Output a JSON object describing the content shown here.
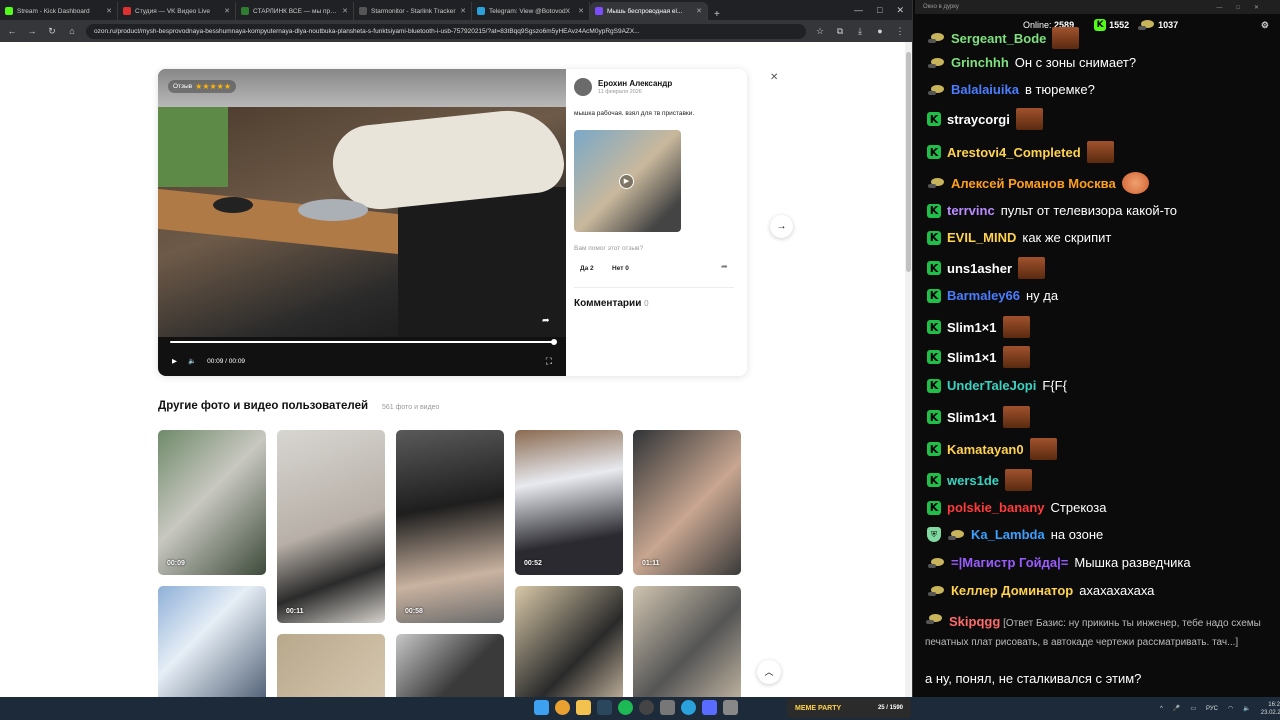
{
  "browser": {
    "tabs": [
      {
        "title": "Stream - Kick Dashboard",
        "color": "#53fc18"
      },
      {
        "title": "Студия — VK Видео Live",
        "color": "#e03131"
      },
      {
        "title": "СТАРЛИНК ВСЁ — мы прогир...",
        "color": "#2e7d32"
      },
      {
        "title": "Starmonitor - Starlink Tracker",
        "color": "#555555"
      },
      {
        "title": "Telegram: View @BotovodX",
        "color": "#2aa1da"
      },
      {
        "title": "Мышь беспроводная el...",
        "color": "#7c4dff"
      }
    ],
    "new_tab": "+",
    "url": "ozon.ru/product/mysh-besprovodnaya-besshumnaya-kompyuternaya-dlya-noutbuka-plansheta-s-funktsiyami-bluetooth-i-usb-757920215/?at=83tBqq9Sgszo6m5yHEAvz4AcM0ypRgS9AZX..."
  },
  "review": {
    "badge": "Отзыв",
    "stars": "★★★★★",
    "author": "Ерохин Александр",
    "date": "11 февраля 2026",
    "text": "мышка рабочая. взял для тв приставки.",
    "helpful_question": "Вам помог этот отзыв?",
    "yes_label": "Да 2",
    "no_label": "Нет 0",
    "comments_label": "Комментарии",
    "comments_count": "0",
    "video_time": "00:09 / 00:09"
  },
  "gallery": {
    "title": "Другие фото и видео пользователей",
    "count": "561 фото и видео",
    "items": [
      {
        "duration": "00:09"
      },
      {
        "duration": "00:11"
      },
      {
        "duration": "00:58"
      },
      {
        "duration": "00:52"
      },
      {
        "duration": "01:11"
      }
    ]
  },
  "chat": {
    "window_title": "Окно в дурку",
    "online_label": "Online:",
    "online_count": "2589",
    "stat1": "1552",
    "stat2": "1037",
    "messages": [
      {
        "user": "Sergeant_Bode",
        "color": "#7ee07e",
        "badge": "g",
        "text": "",
        "emote": true
      },
      {
        "user": "Grinchhh",
        "color": "#7ee07e",
        "badge": "g",
        "text": "Он с зоны снимает?"
      },
      {
        "user": "Balalaiuika",
        "color": "#4a7dff",
        "badge": "g",
        "text": "в тюремке?"
      },
      {
        "user": "straycorgi",
        "color": "#ffffff",
        "badge": "k",
        "text": "",
        "emote": true
      },
      {
        "user": "Arestovi4_Completed",
        "color": "#ffd34d",
        "badge": "k",
        "text": "",
        "emote": true
      },
      {
        "user": "Алексей Романов Москва",
        "color": "#ff9f1a",
        "badge": "g",
        "text": "",
        "emote": true,
        "round": true
      },
      {
        "user": "terrvinc",
        "color": "#b98cff",
        "badge": "k",
        "text": "пульт от телевизора какой-то"
      },
      {
        "user": "EVIL_MIND",
        "color": "#ffd34d",
        "badge": "k",
        "text": "как же скрипит"
      },
      {
        "user": "uns1asher",
        "color": "#ffffff",
        "badge": "k",
        "text": "",
        "emote": true
      },
      {
        "user": "Barmaley66",
        "color": "#4a7dff",
        "badge": "k",
        "text": "ну да"
      },
      {
        "user": "Slim1×1",
        "color": "#ffffff",
        "badge": "k",
        "text": "",
        "emote": true
      },
      {
        "user": "Slim1×1",
        "color": "#ffffff",
        "badge": "k",
        "text": "",
        "emote": true
      },
      {
        "user": "UnderTaleJopi",
        "color": "#3ad3c1",
        "badge": "k",
        "text": "F{F{"
      },
      {
        "user": "Slim1×1",
        "color": "#ffffff",
        "badge": "k",
        "text": "",
        "emote": true
      },
      {
        "user": "Kamatayan0",
        "color": "#ffd34d",
        "badge": "k",
        "text": "",
        "emote": true
      },
      {
        "user": "wers1de",
        "color": "#3ad3c1",
        "badge": "k",
        "text": "",
        "emote": true
      },
      {
        "user": "polskie_banany",
        "color": "#ff3b3b",
        "badge": "k",
        "text": "Стрекоза"
      },
      {
        "user": "Ka_Lambda",
        "color": "#3aa0ff",
        "badge": "sg",
        "text": "на озоне"
      },
      {
        "user": "=|Магистр Гойда|=",
        "color": "#9a5cff",
        "badge": "g",
        "text": "Мышка разведчика"
      },
      {
        "user": "Келлер Доминатор",
        "color": "#ffd34d",
        "badge": "g",
        "text": "ахахахахаха"
      }
    ],
    "long_message": {
      "user": "Skipqgg",
      "text": "[Ответ Базис: ну прикинь ты инженер, тебе надо схемы печатных плат рисовать, в автокаде чертежи рассматривать. тач...]"
    },
    "last_message": "а ну, понял, не сталкивался с этим?"
  },
  "taskbar": {
    "meme_party": "MEME PARTY",
    "meme_count": "25 / 1590",
    "lang": "РУС",
    "time": "16:21",
    "date": "23.02.2026"
  }
}
